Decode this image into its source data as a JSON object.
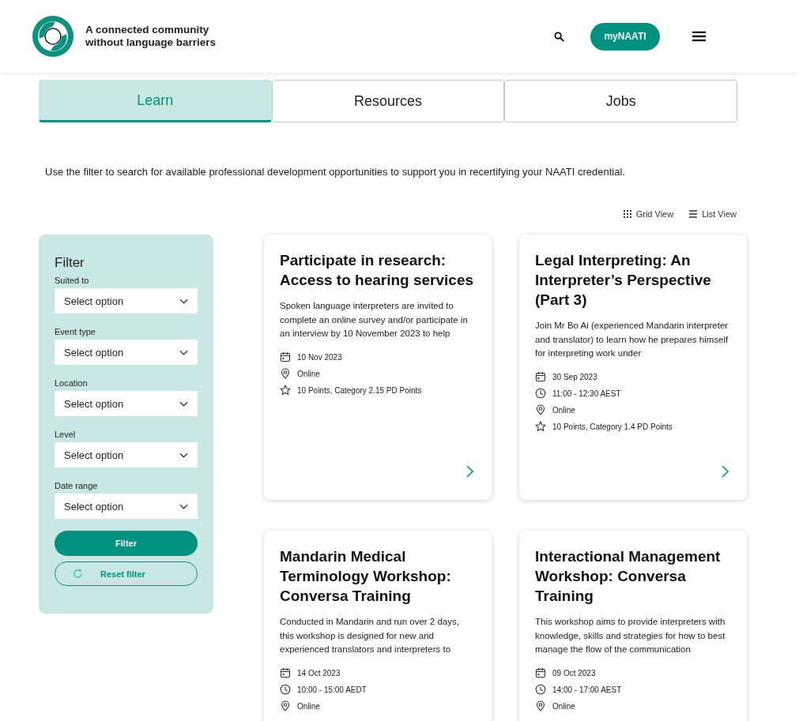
{
  "header": {
    "tagline_lines": [
      "A connected community",
      "without language barriers"
    ],
    "account_button": "myNAATI"
  },
  "tabs": [
    {
      "label": "Learn",
      "selected": true
    },
    {
      "label": "Resources",
      "selected": false
    },
    {
      "label": "Jobs",
      "selected": false
    }
  ],
  "intro": "Use the filter to search for available professional development opportunities to support you in recertifying your NAATI credential.",
  "views": [
    {
      "kind": "grid",
      "label": "Grid View"
    },
    {
      "kind": "list",
      "label": "List View"
    }
  ],
  "filter": {
    "title": "Filter",
    "fields": [
      {
        "label": "Suited to",
        "placeholder": "Select option"
      },
      {
        "label": "Event type",
        "placeholder": "Select option"
      },
      {
        "label": "Location",
        "placeholder": "Select option"
      },
      {
        "label": "Level",
        "placeholder": "Select option"
      },
      {
        "label": "Date range",
        "placeholder": "Select option"
      }
    ],
    "apply_button": "Filter",
    "reset_button": "Reset filter"
  },
  "cards": [
    {
      "title": "Participate in research: Access to hearing services",
      "summary": "Spoken language interpreters are invited to complete an online survey and/or participate in an interview by 10 November 2023 to help",
      "meta": [
        {
          "kind": "date",
          "text": "10 Nov 2023"
        },
        {
          "kind": "location",
          "text": "Online"
        },
        {
          "kind": "points",
          "text": "10 Points, Category 2.15 PD Points"
        }
      ],
      "open_arrow": true
    },
    {
      "title": "Legal Interpreting: An Interpreter’s Perspective (Part 3)",
      "summary": "Join Mr Bo Ai (experienced Mandarin interpreter and translator) to learn how he prepares himself for interpreting work under",
      "meta": [
        {
          "kind": "date",
          "text": "30 Sep 2023"
        },
        {
          "kind": "time",
          "text": "11:00 - 12:30 AEST"
        },
        {
          "kind": "location",
          "text": "Online"
        },
        {
          "kind": "points",
          "text": "10 Points, Category 1.4 PD Points"
        }
      ],
      "open_arrow": true
    },
    {
      "title": "Mandarin Medical Terminology Workshop: Conversa Training",
      "summary": "Conducted in Mandarin and run over 2 days, this workshop is designed for new and experienced translators and interpreters to",
      "meta": [
        {
          "kind": "date",
          "text": "14 Oct 2023"
        },
        {
          "kind": "time",
          "text": "10:00 - 15:00 AEDT"
        },
        {
          "kind": "location",
          "text": "Online"
        }
      ]
    },
    {
      "title": "Interactional Management Workshop: Conversa Training",
      "summary": "This workshop aims to provide interpreters with knowledge, skills and strategies for how to best manage the flow of the communication",
      "meta": [
        {
          "kind": "date",
          "text": "09 Oct 2023"
        },
        {
          "kind": "time",
          "text": "14:00 - 17:00 AEST"
        },
        {
          "kind": "location",
          "text": "Online"
        }
      ]
    }
  ]
}
